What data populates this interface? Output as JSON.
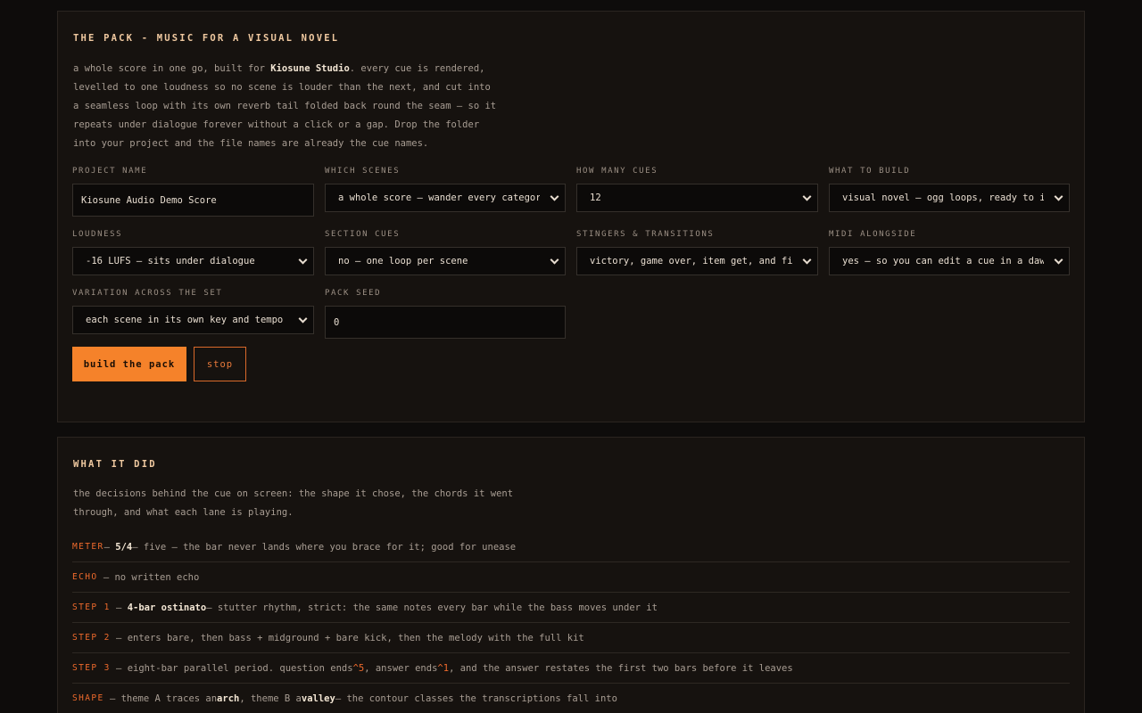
{
  "pack": {
    "title": "THE PACK - MUSIC FOR A VISUAL NOVEL",
    "intro_1": "a whole score in one go, built for ",
    "intro_brand": "Kiosune Studio",
    "intro_2": ". every cue is rendered, levelled to one loudness so no scene is louder than the next, and cut into a seamless loop with its own reverb tail folded back round the seam — so it repeats under dialogue forever without a click or a gap. Drop the folder into your project and the file names are already the cue names.",
    "fields": {
      "project_name": {
        "label": "PROJECT NAME",
        "value": "Kiosune Audio Demo Score"
      },
      "which_scenes": {
        "label": "WHICH SCENES",
        "value": "a whole score — wander every category"
      },
      "how_many_cues": {
        "label": "HOW MANY CUES",
        "value": "12"
      },
      "what_to_build": {
        "label": "WHAT TO BUILD",
        "value": "visual novel — ogg loops, ready to import"
      },
      "loudness": {
        "label": "LOUDNESS",
        "value": "-16 LUFS — sits under dialogue"
      },
      "section_cues": {
        "label": "SECTION CUES",
        "value": "no — one loop per scene"
      },
      "stingers": {
        "label": "STINGERS & TRANSITIONS",
        "value": "victory, game over, item get, and five transitions"
      },
      "midi": {
        "label": "MIDI ALONGSIDE",
        "value": "yes — so you can edit a cue in a daw later"
      },
      "variation": {
        "label": "VARIATION ACROSS THE SET",
        "value": "each scene in its own key and tempo"
      },
      "pack_seed": {
        "label": "PACK SEED",
        "value": "0"
      }
    },
    "build_label": "build the pack",
    "stop_label": "stop"
  },
  "did": {
    "title": "WHAT IT DID",
    "intro": "the decisions behind the cue on screen: the shape it chose, the chords it went through, and what each lane is playing.",
    "rows": {
      "meter": {
        "key": "METER",
        "a": " — ",
        "b": "5/4",
        "c": " — five — the bar never lands where you brace for it; good for unease"
      },
      "echo": {
        "key": "ECHO",
        "a": " — no written echo"
      },
      "step1": {
        "key": "STEP 1",
        "a": " — ",
        "b": "4-bar ostinato",
        "c": " — stutter rhythm, strict: the same notes every bar while the bass moves under it"
      },
      "step2": {
        "key": "STEP 2",
        "a": " — enters bare, then bass + midground + bare kick, then the melody with the full kit"
      },
      "step3": {
        "key": "STEP 3",
        "a": " — eight-bar parallel period. question ends ",
        "h1": "^5",
        "b": ", answer ends ",
        "h2": "^1",
        "c": ", and the answer restates the first two bars before it leaves"
      },
      "shape": {
        "key": "SHAPE",
        "a": " — theme A traces an ",
        "b": "arch",
        "c": ", theme B a ",
        "d": "valley",
        "e": " — the contour classes the transcriptions fall into"
      }
    }
  },
  "colors": {
    "background": "#0e0c0b",
    "panel": "#16120f",
    "accent": "#f5822a",
    "key_label": "#ee6a2c",
    "title": "#f0c9a0"
  },
  "icons": {
    "select": "chevron-down-icon"
  }
}
